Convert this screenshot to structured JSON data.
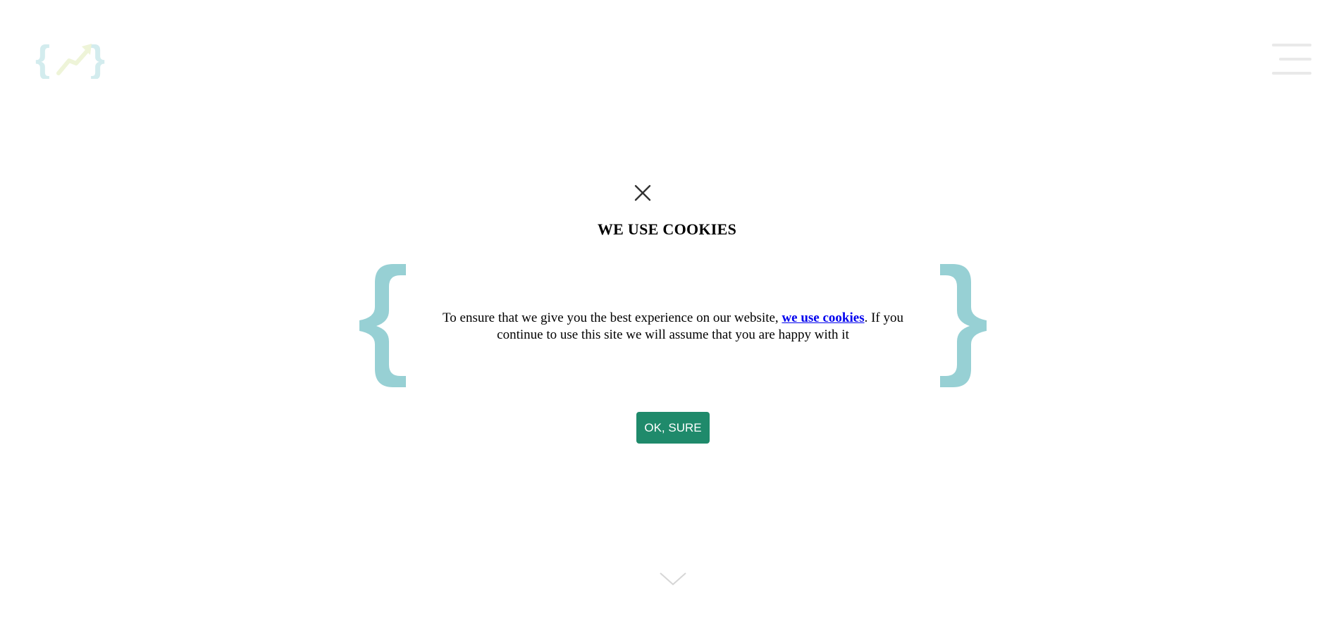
{
  "header": {
    "logo_icon": "curly-brace-trend-logo",
    "menu_icon": "hamburger-menu-icon"
  },
  "cookie_modal": {
    "title": "WE USE COOKIES",
    "text_before_link": "To ensure that we give you the best experience on our website, ",
    "link_label": "we use cookies",
    "text_after_link": ". If you continue to use this site we will assume that you are happy with it",
    "accept_label": "OK, SURE",
    "close_icon": "close-icon",
    "brace_color": "#97d0d4",
    "button_color": "#1f8a6b",
    "link_color": "#0000ee"
  },
  "footer": {
    "scroll_icon": "chevron-down-icon"
  }
}
